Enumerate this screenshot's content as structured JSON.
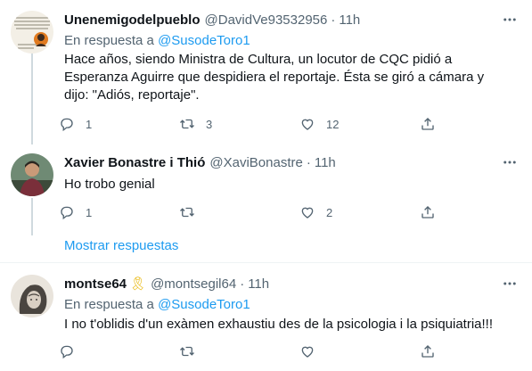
{
  "tweets": [
    {
      "name": "Unenemigodelpueblo",
      "handle": "@DavidVe93532956",
      "dot": "·",
      "time": "11h",
      "reply_prefix": "En respuesta a",
      "reply_mention": "@SusodeToro1",
      "text_lines": [
        "Hace años, siendo Ministra de Cultura, un locutor de CQC pidió a",
        "Esperanza Aguirre que  despidiera el reportaje. Ésta se giró a cámara y",
        "dijo: \"Adiós, reportaje\"."
      ],
      "replies": "1",
      "retweets": "3",
      "likes": "12"
    },
    {
      "name": "Xavier Bonastre i Thió",
      "handle": "@XaviBonastre",
      "dot": "·",
      "time": "11h",
      "text_lines": [
        "Ho trobo genial"
      ],
      "replies": "1",
      "retweets": "",
      "likes": "2"
    },
    {
      "name": "montse64",
      "badge": "🎗",
      "handle": "@montsegil64",
      "dot": "·",
      "time": "11h",
      "reply_prefix": "En respuesta a",
      "reply_mention": "@SusodeToro1",
      "text_lines": [
        "I no t'oblidis d'un exàmen exhaustiu des de la psicologia i la psiquiatria!!!"
      ],
      "replies": "",
      "retweets": "",
      "likes": ""
    }
  ],
  "show_replies": "Mostrar respuestas",
  "icons": {
    "more": "more-dots-icon",
    "reply": "reply-bubble-icon",
    "retweet": "retweet-icon",
    "like": "heart-icon",
    "share": "share-upload-icon"
  },
  "colors": {
    "text": "#0f1419",
    "secondary": "#536471",
    "link": "#1d9bf0",
    "divider": "#eff3f4",
    "thread_line": "#cfd9de"
  }
}
